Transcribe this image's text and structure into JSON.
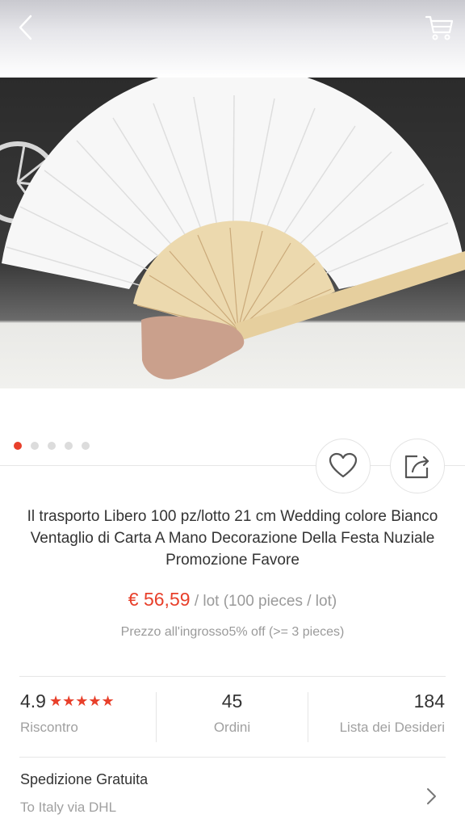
{
  "header": {
    "back_icon": "chevron-left-icon",
    "cart_icon": "shopping-cart-icon"
  },
  "gallery": {
    "image": "white paper hand fan with bamboo frame",
    "dots_count": 5,
    "active_index": 0
  },
  "actions": {
    "wishlist_icon": "heart-icon",
    "share_icon": "share-icon"
  },
  "product": {
    "title": "Il trasporto Libero 100 pz/lotto 21 cm Wedding colore Bianco Ventaglio di Carta A Mano Decorazione Della Festa Nuziale Promozione Favore",
    "price": "€ 56,59",
    "price_unit": " / lot (100 pieces / lot)",
    "wholesale": "Prezzo all'ingrosso5% off (>= 3 pieces)"
  },
  "stats": {
    "rating": "4.9",
    "rating_stars": "★★★★★",
    "rating_label": "Riscontro",
    "orders": "45",
    "orders_label": "Ordini",
    "wishlist": "184",
    "wishlist_label": "Lista dei Desideri"
  },
  "shipping": {
    "title": "Spedizione Gratuita",
    "subtitle": "To Italy via DHL"
  },
  "colors": {
    "accent": "#e8402b",
    "muted": "#9a9a9a"
  }
}
